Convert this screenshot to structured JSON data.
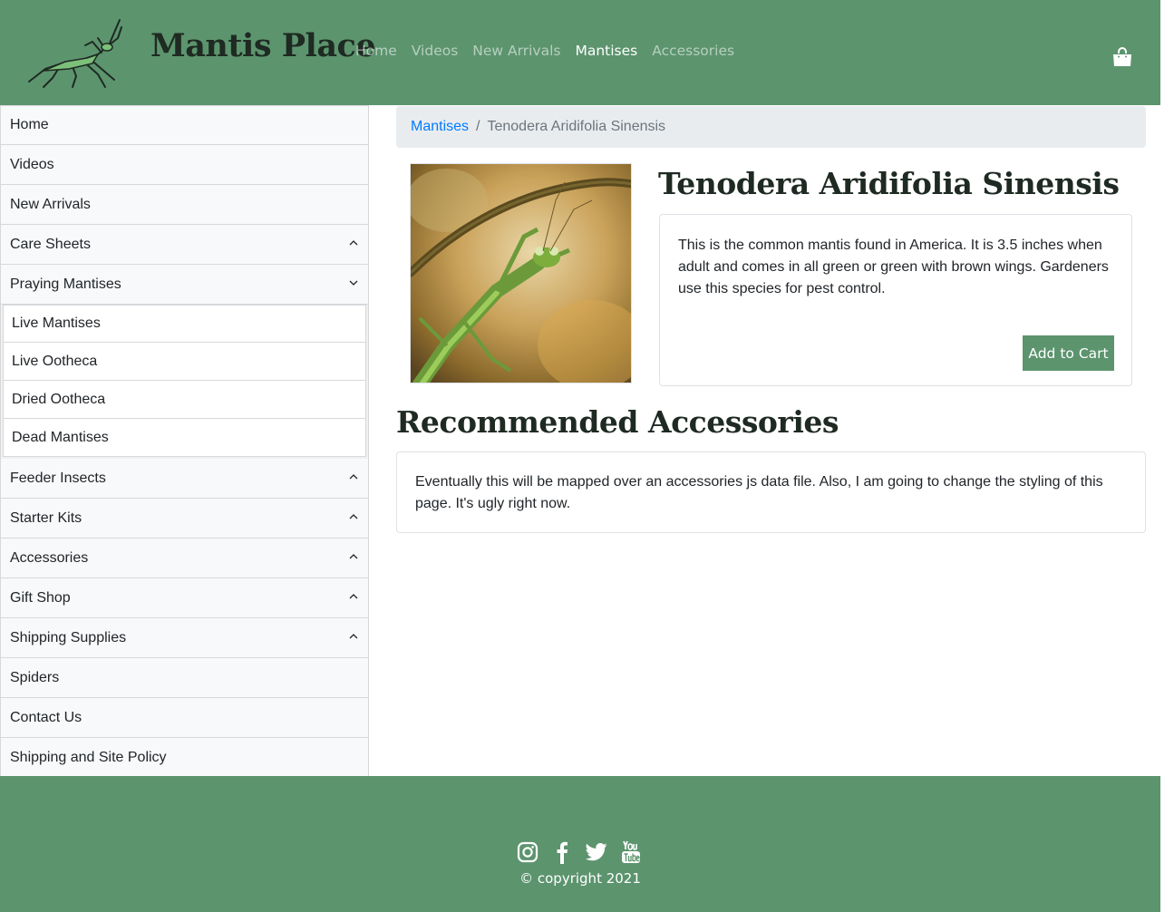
{
  "header": {
    "site_title": "Mantis Place",
    "nav": [
      {
        "label": "Home",
        "active": false
      },
      {
        "label": "Videos",
        "active": false
      },
      {
        "label": "New Arrivals",
        "active": false
      },
      {
        "label": "Mantises",
        "active": true
      },
      {
        "label": "Accessories",
        "active": false
      }
    ],
    "cart_icon": "shopping-bag-icon",
    "brand_color": "#5c946e"
  },
  "sidebar": {
    "items": [
      {
        "label": "Home",
        "chevron": "none"
      },
      {
        "label": "Videos",
        "chevron": "none"
      },
      {
        "label": "New Arrivals",
        "chevron": "none"
      },
      {
        "label": "Care Sheets",
        "chevron": "up"
      },
      {
        "label": "Praying Mantises",
        "chevron": "down"
      },
      {
        "label": "Feeder Insects",
        "chevron": "up"
      },
      {
        "label": "Starter Kits",
        "chevron": "up"
      },
      {
        "label": "Accessories",
        "chevron": "up"
      },
      {
        "label": "Gift Shop",
        "chevron": "up"
      },
      {
        "label": "Shipping Supplies",
        "chevron": "up"
      },
      {
        "label": "Spiders",
        "chevron": "none"
      },
      {
        "label": "Contact Us",
        "chevron": "none"
      },
      {
        "label": "Shipping and Site Policy",
        "chevron": "none"
      }
    ],
    "praying_mantises_sub": [
      "Live Mantises",
      "Live Ootheca",
      "Dried Ootheca",
      "Dead Mantises"
    ]
  },
  "breadcrumb": {
    "parent": "Mantises",
    "separator": "/",
    "current": "Tenodera Aridifolia Sinensis"
  },
  "product": {
    "title": "Tenodera Aridifolia Sinensis",
    "description": "This is the common mantis found in America. It is 3.5 inches when adult and comes in all green or green with brown wings. Gardeners use this species for pest control.",
    "add_to_cart_label": "Add to Cart"
  },
  "recommended": {
    "title": "Recommended Accessories",
    "text": "Eventually this will be mapped over an accessories js data file. Also, I am going to change the styling of this page. It's ugly right now."
  },
  "footer": {
    "social": [
      "instagram-icon",
      "facebook-icon",
      "twitter-icon",
      "youtube-icon"
    ],
    "copyright": "© copyright 2021"
  }
}
